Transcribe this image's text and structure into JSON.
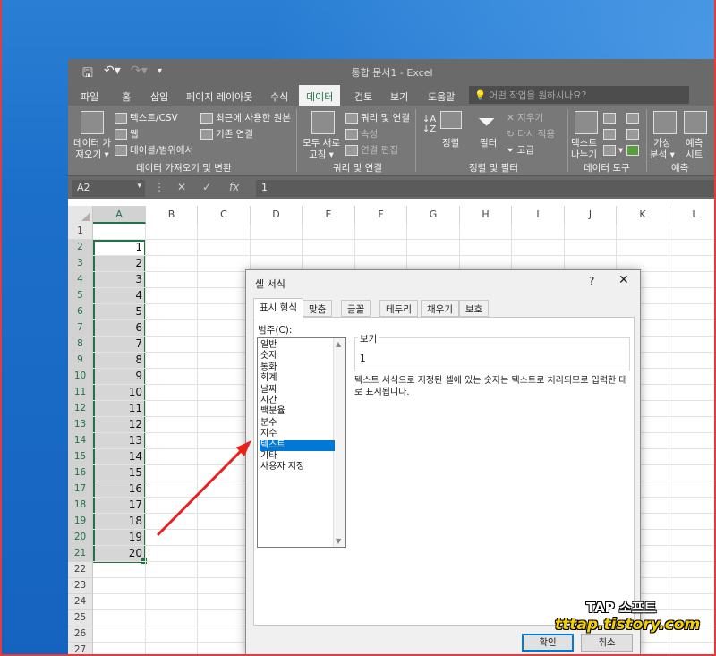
{
  "window": {
    "title": "통합 문서1  -  Excel",
    "undo_icon": "undo-icon",
    "save_icon": "save-icon"
  },
  "ribbon_tabs": [
    "파일",
    "홈",
    "삽입",
    "페이지 레이아웃",
    "수식",
    "데이터",
    "검토",
    "보기",
    "도움말"
  ],
  "active_tab": "데이터",
  "tell_me": "어떤 작업을 원하시나요?",
  "ribbon": {
    "get_data": "데이터 가져오기",
    "get_data_line1": "데이터 가",
    "get_data_line2": "져오기 ▾",
    "from_text": "텍스트/CSV",
    "from_web": "웹",
    "from_table": "테이블/범위에서",
    "recent_sources": "최근에 사용한 원본",
    "existing_conn": "기존 연결",
    "group_get": "데이터 가져오기 및 변환",
    "refresh_all_1": "모두 새로",
    "refresh_all_2": "고침 ▾",
    "queries_conn": "쿼리 및 연결",
    "properties": "속성",
    "edit_links": "연결 편집",
    "group_queries": "쿼리 및 연결",
    "sort": "정렬",
    "filter": "필터",
    "clear": "지우기",
    "reapply": "다시 적용",
    "advanced": "고급",
    "group_sort": "정렬 및 필터",
    "text_to_cols_1": "텍스트",
    "text_to_cols_2": "나누기",
    "group_tools": "데이터 도구",
    "whatif_1": "가상",
    "whatif_2": "분석 ▾",
    "forecast_1": "예측",
    "forecast_2": "시트",
    "group_forecast": "예측"
  },
  "formula_bar": {
    "name_box": "A2",
    "value": "1",
    "fx": "fx"
  },
  "columns": [
    "A",
    "B",
    "C",
    "D",
    "E",
    "F",
    "G",
    "H",
    "I",
    "J",
    "K",
    "L"
  ],
  "rows": [
    "1",
    "2",
    "3",
    "4",
    "5",
    "6",
    "7",
    "8",
    "9",
    "10",
    "11",
    "12",
    "13",
    "14",
    "15",
    "16",
    "17",
    "18",
    "19",
    "20",
    "21",
    "22",
    "23",
    "24",
    "25",
    "26",
    "27"
  ],
  "cells_a": [
    "",
    "1",
    "2",
    "3",
    "4",
    "5",
    "6",
    "7",
    "8",
    "9",
    "10",
    "11",
    "12",
    "13",
    "14",
    "15",
    "16",
    "17",
    "18",
    "19",
    "20"
  ],
  "dialog": {
    "title": "셀 서식",
    "help": "?",
    "close": "✕",
    "tabs": [
      "표시 형식",
      "맞춤",
      "글꼴",
      "테두리",
      "채우기",
      "보호"
    ],
    "category_label": "범주(C):",
    "categories": [
      "일반",
      "숫자",
      "통화",
      "회계",
      "날짜",
      "시간",
      "백분율",
      "분수",
      "지수",
      "텍스트",
      "기타",
      "사용자 지정"
    ],
    "selected_category": "텍스트",
    "sample_label": "보기",
    "sample_value": "1",
    "description": "텍스트 서식으로 지정된 셀에 있는 숫자는 텍스트로 처리되므로 입력한 대로 표시됩니다.",
    "ok": "확인",
    "cancel": "취소"
  },
  "watermark": {
    "line1": "TAP 소프트",
    "line2": "tttap.tistory.com"
  },
  "colors": {
    "excel_green": "#217346",
    "arrow": "#e8211b",
    "selection": "#0078d7"
  }
}
